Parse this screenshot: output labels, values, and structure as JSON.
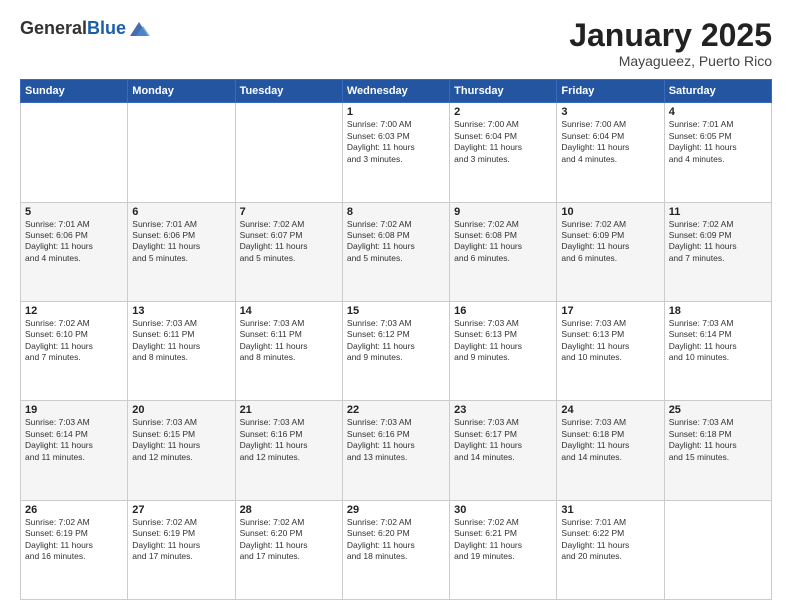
{
  "header": {
    "logo_general": "General",
    "logo_blue": "Blue",
    "month_title": "January 2025",
    "location": "Mayagueez, Puerto Rico"
  },
  "weekdays": [
    "Sunday",
    "Monday",
    "Tuesday",
    "Wednesday",
    "Thursday",
    "Friday",
    "Saturday"
  ],
  "weeks": [
    [
      {
        "day": "",
        "info": ""
      },
      {
        "day": "",
        "info": ""
      },
      {
        "day": "",
        "info": ""
      },
      {
        "day": "1",
        "info": "Sunrise: 7:00 AM\nSunset: 6:03 PM\nDaylight: 11 hours\nand 3 minutes."
      },
      {
        "day": "2",
        "info": "Sunrise: 7:00 AM\nSunset: 6:04 PM\nDaylight: 11 hours\nand 3 minutes."
      },
      {
        "day": "3",
        "info": "Sunrise: 7:00 AM\nSunset: 6:04 PM\nDaylight: 11 hours\nand 4 minutes."
      },
      {
        "day": "4",
        "info": "Sunrise: 7:01 AM\nSunset: 6:05 PM\nDaylight: 11 hours\nand 4 minutes."
      }
    ],
    [
      {
        "day": "5",
        "info": "Sunrise: 7:01 AM\nSunset: 6:06 PM\nDaylight: 11 hours\nand 4 minutes."
      },
      {
        "day": "6",
        "info": "Sunrise: 7:01 AM\nSunset: 6:06 PM\nDaylight: 11 hours\nand 5 minutes."
      },
      {
        "day": "7",
        "info": "Sunrise: 7:02 AM\nSunset: 6:07 PM\nDaylight: 11 hours\nand 5 minutes."
      },
      {
        "day": "8",
        "info": "Sunrise: 7:02 AM\nSunset: 6:08 PM\nDaylight: 11 hours\nand 5 minutes."
      },
      {
        "day": "9",
        "info": "Sunrise: 7:02 AM\nSunset: 6:08 PM\nDaylight: 11 hours\nand 6 minutes."
      },
      {
        "day": "10",
        "info": "Sunrise: 7:02 AM\nSunset: 6:09 PM\nDaylight: 11 hours\nand 6 minutes."
      },
      {
        "day": "11",
        "info": "Sunrise: 7:02 AM\nSunset: 6:09 PM\nDaylight: 11 hours\nand 7 minutes."
      }
    ],
    [
      {
        "day": "12",
        "info": "Sunrise: 7:02 AM\nSunset: 6:10 PM\nDaylight: 11 hours\nand 7 minutes."
      },
      {
        "day": "13",
        "info": "Sunrise: 7:03 AM\nSunset: 6:11 PM\nDaylight: 11 hours\nand 8 minutes."
      },
      {
        "day": "14",
        "info": "Sunrise: 7:03 AM\nSunset: 6:11 PM\nDaylight: 11 hours\nand 8 minutes."
      },
      {
        "day": "15",
        "info": "Sunrise: 7:03 AM\nSunset: 6:12 PM\nDaylight: 11 hours\nand 9 minutes."
      },
      {
        "day": "16",
        "info": "Sunrise: 7:03 AM\nSunset: 6:13 PM\nDaylight: 11 hours\nand 9 minutes."
      },
      {
        "day": "17",
        "info": "Sunrise: 7:03 AM\nSunset: 6:13 PM\nDaylight: 11 hours\nand 10 minutes."
      },
      {
        "day": "18",
        "info": "Sunrise: 7:03 AM\nSunset: 6:14 PM\nDaylight: 11 hours\nand 10 minutes."
      }
    ],
    [
      {
        "day": "19",
        "info": "Sunrise: 7:03 AM\nSunset: 6:14 PM\nDaylight: 11 hours\nand 11 minutes."
      },
      {
        "day": "20",
        "info": "Sunrise: 7:03 AM\nSunset: 6:15 PM\nDaylight: 11 hours\nand 12 minutes."
      },
      {
        "day": "21",
        "info": "Sunrise: 7:03 AM\nSunset: 6:16 PM\nDaylight: 11 hours\nand 12 minutes."
      },
      {
        "day": "22",
        "info": "Sunrise: 7:03 AM\nSunset: 6:16 PM\nDaylight: 11 hours\nand 13 minutes."
      },
      {
        "day": "23",
        "info": "Sunrise: 7:03 AM\nSunset: 6:17 PM\nDaylight: 11 hours\nand 14 minutes."
      },
      {
        "day": "24",
        "info": "Sunrise: 7:03 AM\nSunset: 6:18 PM\nDaylight: 11 hours\nand 14 minutes."
      },
      {
        "day": "25",
        "info": "Sunrise: 7:03 AM\nSunset: 6:18 PM\nDaylight: 11 hours\nand 15 minutes."
      }
    ],
    [
      {
        "day": "26",
        "info": "Sunrise: 7:02 AM\nSunset: 6:19 PM\nDaylight: 11 hours\nand 16 minutes."
      },
      {
        "day": "27",
        "info": "Sunrise: 7:02 AM\nSunset: 6:19 PM\nDaylight: 11 hours\nand 17 minutes."
      },
      {
        "day": "28",
        "info": "Sunrise: 7:02 AM\nSunset: 6:20 PM\nDaylight: 11 hours\nand 17 minutes."
      },
      {
        "day": "29",
        "info": "Sunrise: 7:02 AM\nSunset: 6:20 PM\nDaylight: 11 hours\nand 18 minutes."
      },
      {
        "day": "30",
        "info": "Sunrise: 7:02 AM\nSunset: 6:21 PM\nDaylight: 11 hours\nand 19 minutes."
      },
      {
        "day": "31",
        "info": "Sunrise: 7:01 AM\nSunset: 6:22 PM\nDaylight: 11 hours\nand 20 minutes."
      },
      {
        "day": "",
        "info": ""
      }
    ]
  ]
}
